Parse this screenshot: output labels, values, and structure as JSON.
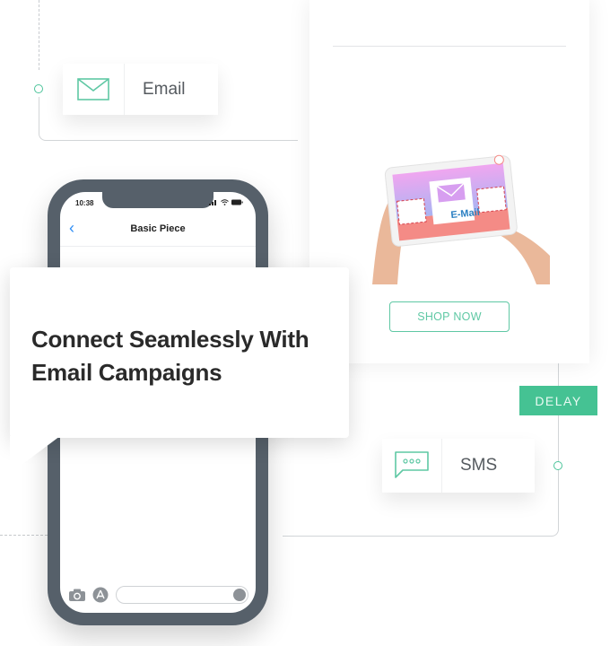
{
  "flow": {
    "email_channel": {
      "label": "Email",
      "icon": "envelope-icon"
    },
    "sms_channel": {
      "label": "SMS",
      "icon": "chat-bubble-icon"
    },
    "delay_badge": "DELAY"
  },
  "preview": {
    "image_text": "E-Mail",
    "cta_label": "SHOP NOW"
  },
  "phone": {
    "status_time": "10:38",
    "status_icons": [
      "signal-icon",
      "wifi-icon",
      "battery-icon"
    ],
    "nav_back_icon": "chevron-left-icon",
    "nav_title": "Basic Piece",
    "bottom_icons": [
      "camera-icon",
      "app-store-icon",
      "microphone-icon"
    ],
    "message_placeholder": ""
  },
  "callout": {
    "line1": "Connect Seamlessly With",
    "line2": "Email Campaigns"
  },
  "colors": {
    "accent": "#45c293",
    "accent_outline": "#5fc8a4",
    "phone_frame": "#56606a",
    "ios_blue": "#2f8ef5",
    "heading": "#2a2a2a"
  }
}
